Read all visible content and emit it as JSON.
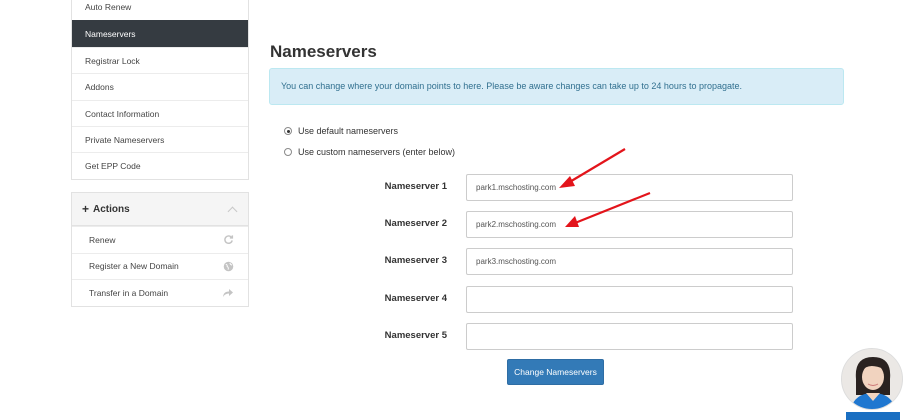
{
  "sidebar": {
    "items": [
      {
        "label": "Auto Renew"
      },
      {
        "label": "Nameservers"
      },
      {
        "label": "Registrar Lock"
      },
      {
        "label": "Addons"
      },
      {
        "label": "Contact Information"
      },
      {
        "label": "Private Nameservers"
      },
      {
        "label": "Get EPP Code"
      }
    ],
    "active_index": 1
  },
  "actions": {
    "header": "Actions",
    "plus_icon": "plus-icon",
    "items": [
      {
        "label": "Renew",
        "icon": "refresh-icon"
      },
      {
        "label": "Register a New Domain",
        "icon": "globe-icon"
      },
      {
        "label": "Transfer in a Domain",
        "icon": "share-arrow-icon"
      }
    ]
  },
  "main": {
    "title": "Nameservers",
    "alert": "You can change where your domain points to here. Please be aware changes can take up to 24 hours to propagate.",
    "options": [
      {
        "label": "Use default nameservers",
        "checked": true
      },
      {
        "label": "Use custom nameservers (enter below)",
        "checked": false
      }
    ],
    "nameservers": [
      {
        "label": "Nameserver 1",
        "value": "park1.mschosting.com"
      },
      {
        "label": "Nameserver 2",
        "value": "park2.mschosting.com"
      },
      {
        "label": "Nameserver 3",
        "value": "park3.mschosting.com"
      },
      {
        "label": "Nameserver 4",
        "value": ""
      },
      {
        "label": "Nameserver 5",
        "value": ""
      }
    ],
    "submit_label": "Change Nameservers"
  },
  "colors": {
    "active_menu_bg": "#353b41",
    "alert_bg": "#d9edf7",
    "alert_text": "#31708f",
    "primary_button": "#337ab7",
    "annotation_arrow": "#e3141b"
  }
}
